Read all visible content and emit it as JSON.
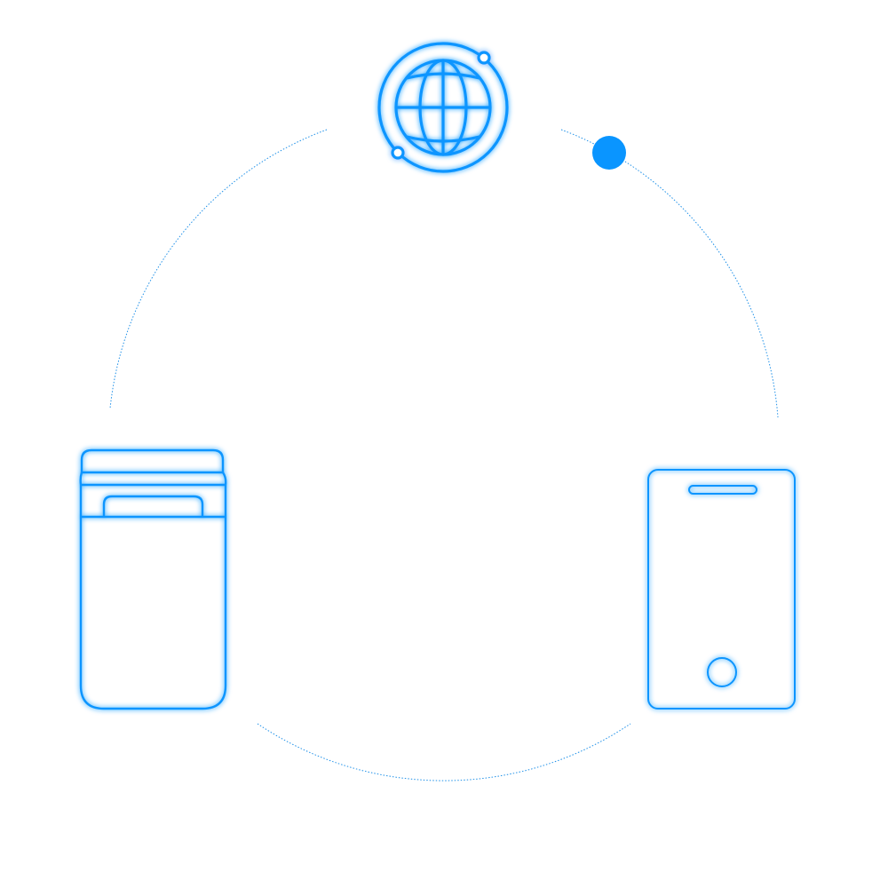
{
  "diagram": {
    "nodes": [
      {
        "id": "internet",
        "icon": "globe-icon"
      },
      {
        "id": "router",
        "icon": "router-icon"
      },
      {
        "id": "phone",
        "icon": "smartphone-icon"
      }
    ],
    "connector": "dashed-circle",
    "indicator": "orbit-dot"
  },
  "colors": {
    "accent": "#0A95FF",
    "accent_glow": "#7CC6FF",
    "ring": "#1E90E8",
    "background": "#FFFFFF"
  }
}
